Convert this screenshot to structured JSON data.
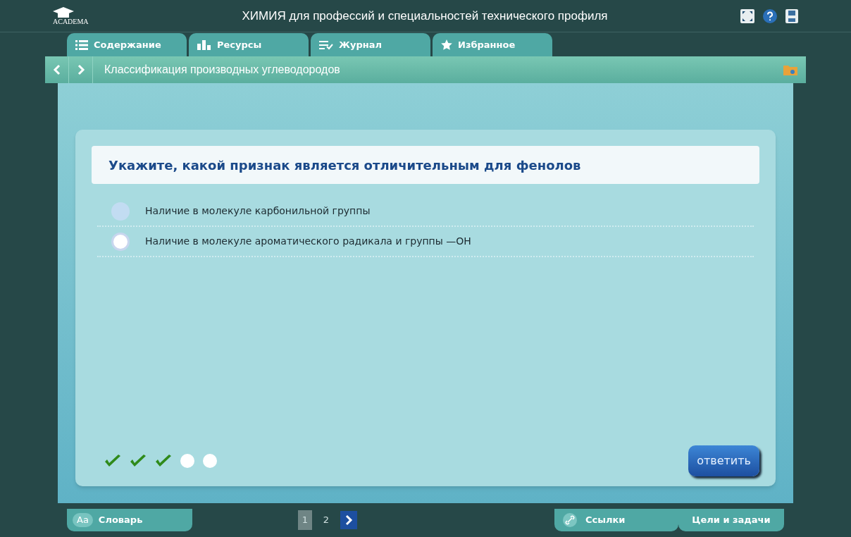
{
  "header": {
    "logo": "ACADEMA",
    "title": "ХИМИЯ для профессий и специальностей технического профиля"
  },
  "tabs": [
    {
      "label": "Содержание",
      "kind": "list",
      "selected": false
    },
    {
      "label": "Ресурсы",
      "kind": "bars",
      "selected": false
    },
    {
      "label": "Журнал",
      "kind": "journal",
      "selected": false
    },
    {
      "label": "Избранное",
      "kind": "star",
      "selected": false
    }
  ],
  "breadcrumb": {
    "title": "Классификация производных углеводородов"
  },
  "question": {
    "text": "Укажите, какой признак является отличительным для фенолов",
    "options": [
      {
        "label": "Наличие в молекуле карбонильной группы",
        "selected": false,
        "highlighted": true
      },
      {
        "label": "Наличие в молекуле ароматического радикала и группы —ОН",
        "selected": false,
        "highlighted": false
      }
    ]
  },
  "progress": [
    {
      "done": true
    },
    {
      "done": true
    },
    {
      "done": true
    },
    {
      "done": false
    },
    {
      "done": false
    }
  ],
  "answer_button": "ответить",
  "footer": {
    "glossary_badge": "Aa",
    "glossary": "Словарь",
    "pages": [
      {
        "label": "1",
        "selected": true
      },
      {
        "label": "2",
        "selected": false
      }
    ],
    "links": "Ссылки",
    "goals": "Цели и задачи"
  }
}
